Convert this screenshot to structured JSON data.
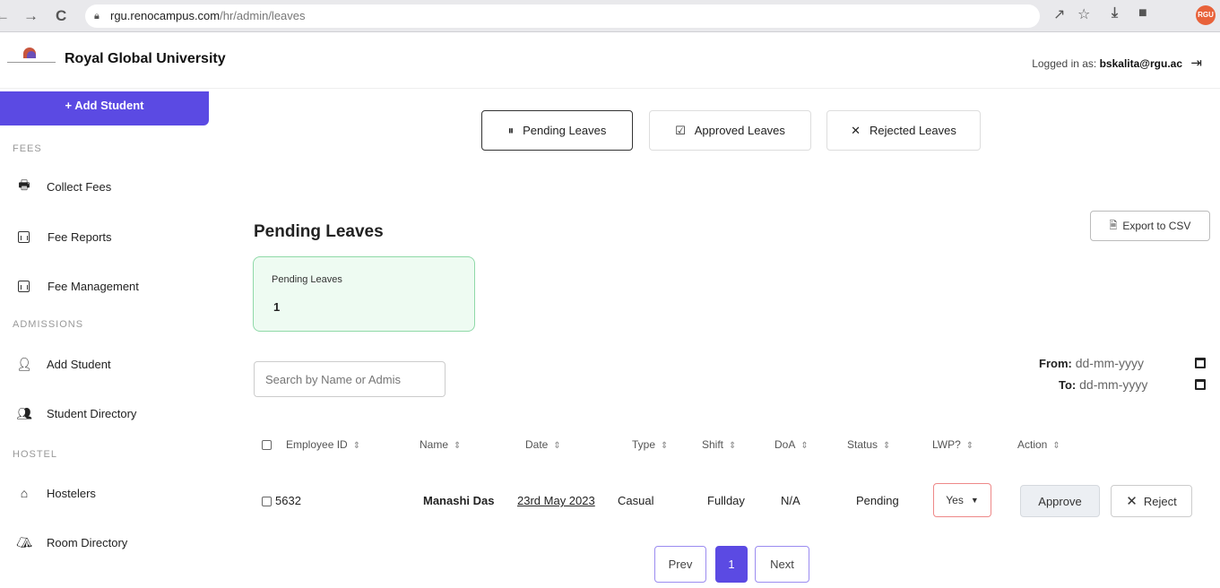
{
  "browser": {
    "back": "←",
    "forward": "→",
    "reload": "C",
    "url_host": "rgu.renocampus.com",
    "url_path": "/hr/admin/leaves",
    "avatar_text": "RGU"
  },
  "header": {
    "brand": "Royal Global University",
    "logged_in_prefix": "Logged in as:",
    "user_email": "bskalita@rgu.ac"
  },
  "sidebar": {
    "add_student_button": "+ Add Student",
    "sections": {
      "fees": "FEES",
      "admissions": "ADMISSIONS",
      "hostel": "HOSTEL"
    },
    "items": [
      {
        "label": "Collect Fees",
        "icon": "cash-register-icon"
      },
      {
        "label": "Fee Reports",
        "icon": "chart-icon"
      },
      {
        "label": "Fee Management",
        "icon": "chart-icon"
      },
      {
        "label": "Add Student",
        "icon": "user-plus-icon"
      },
      {
        "label": "Student Directory",
        "icon": "users-icon"
      },
      {
        "label": "Hostelers",
        "icon": "home-icon"
      },
      {
        "label": "Room Directory",
        "icon": "building-icon"
      }
    ]
  },
  "tabs": [
    {
      "label": "Pending Leaves",
      "icon": "pause-circle-icon",
      "active": true
    },
    {
      "label": "Approved Leaves",
      "icon": "check-square-icon",
      "active": false
    },
    {
      "label": "Rejected Leaves",
      "icon": "x-icon",
      "active": false
    }
  ],
  "main": {
    "title": "Pending Leaves",
    "export_button": "Export to CSV",
    "stat_card": {
      "label": "Pending Leaves",
      "value": "1"
    },
    "search_placeholder": "Search by Name or Admis",
    "from_label": "From:",
    "to_label": "To:",
    "date_placeholder": "dd-mm-yyyy"
  },
  "table": {
    "columns": [
      "Employee ID",
      "Name",
      "Date",
      "Type",
      "Shift",
      "DoA",
      "Status",
      "LWP?",
      "Action"
    ],
    "rows": [
      {
        "employee_id": "5632",
        "name": "Manashi Das",
        "date": "23rd May 2023",
        "type": "Casual",
        "shift": "Fullday",
        "doa": "N/A",
        "status": "Pending",
        "lwp": "Yes",
        "approve": "Approve",
        "reject": "Reject"
      }
    ]
  },
  "pagination": {
    "prev": "Prev",
    "current": "1",
    "next": "Next"
  },
  "colors": {
    "accent": "#5b4ae3",
    "card_bg": "#eefbf2",
    "card_border": "#8fd9a8"
  }
}
